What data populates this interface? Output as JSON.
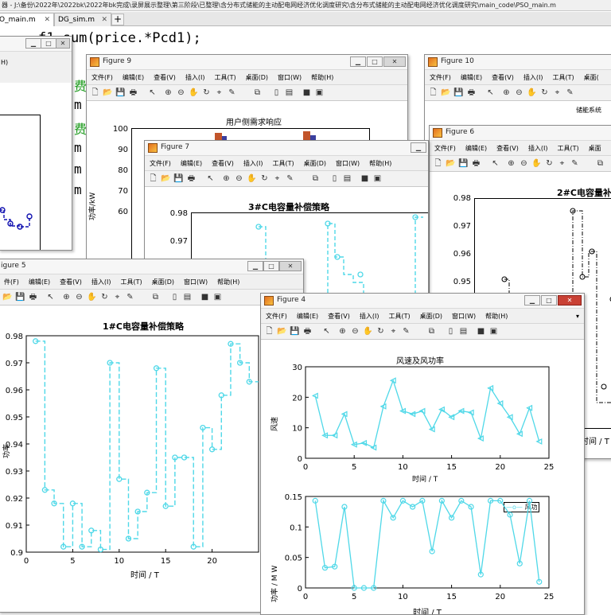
{
  "editor": {
    "path": "器 - J:\\备份\\2022年\\2022bk\\2022年bk完成\\录屏展示整理\\第三阶段\\已整理\\含分布式储能的主动配电网经济优化调度研究\\含分布式储能的主动配电网经济优化调度研究\\main_code\\PSO_main.m",
    "tabs": [
      {
        "label": "O_main.m"
      },
      {
        "label": "DG_sim.m"
      }
    ],
    "code_line": "f1=sum(price.*Pcd1);",
    "background_chars": [
      "费",
      "m",
      "费",
      "m",
      "m",
      "负",
      "m"
    ]
  },
  "win_partial": {
    "title_fragment": "H)"
  },
  "figure9": {
    "title": "Figure 9",
    "menu": [
      "文件(F)",
      "编辑(E)",
      "查看(V)",
      "插入(I)",
      "工具(T)",
      "桌面(D)",
      "窗口(W)",
      "帮助(H)"
    ],
    "chart_title": "用户侧需求响应",
    "yticks": [
      "100",
      "90",
      "80",
      "70",
      "60"
    ],
    "ylabel": "功率/kW"
  },
  "figure10": {
    "title": "Figure 10",
    "menu": [
      "文件(F)",
      "编辑(E)",
      "查看(V)",
      "插入(I)",
      "工具(T)",
      "桌面("
    ],
    "chart_title": "储能系统"
  },
  "figure6": {
    "title": "Figure 6",
    "menu": [
      "文件(F)",
      "编辑(E)",
      "查看(V)",
      "插入(I)",
      "工具(T)",
      "桌面"
    ],
    "chart_title": "2#C电容量补偿",
    "yticks": [
      "0.98",
      "0.97",
      "0.96",
      "0.95"
    ],
    "xlabel": "时间 / T"
  },
  "figure7": {
    "title": "Figure 7",
    "menu": [
      "文件(F)",
      "编辑(E)",
      "查看(V)",
      "插入(I)",
      "工具(T)",
      "桌面(D)",
      "窗口(W)",
      "帮助(H)"
    ],
    "chart_title": "3#C电容量补偿策略",
    "yticks": [
      "0.98",
      "0.97"
    ]
  },
  "figure5": {
    "title": "igure 5",
    "menu": [
      "件(F)",
      "编辑(E)",
      "查看(V)",
      "插入(I)",
      "工具(T)",
      "桌面(D)",
      "窗口(W)",
      "帮助(H)"
    ],
    "chart_title": "1#C电容量补偿策略",
    "yticks": [
      "0.98",
      "0.97",
      "0.96",
      "0.95",
      "0.94",
      "0.93",
      "0.92",
      "0.91",
      "0.9"
    ],
    "xticks": [
      "0",
      "5",
      "10",
      "15",
      "20"
    ],
    "xlabel": "时间 / T",
    "ylabel": "功率"
  },
  "figure4": {
    "title": "Figure 4",
    "menu": [
      "文件(F)",
      "编辑(E)",
      "查看(V)",
      "插入(I)",
      "工具(T)",
      "桌面(D)",
      "窗口(W)",
      "帮助(H)"
    ]
  },
  "colors": {
    "cyan": "#4fd8e8",
    "blue": "#1010b0",
    "black": "#000000"
  },
  "chart_data": [
    {
      "type": "line",
      "title": "1#C电容量补偿策略",
      "xlabel": "时间 / T",
      "ylabel": "功率",
      "xlim": [
        0,
        25
      ],
      "ylim": [
        0.9,
        0.98
      ],
      "style": "stairs-dashed",
      "series": [
        {
          "x": [
            1,
            2,
            3,
            4,
            5,
            6,
            7,
            8,
            9,
            10,
            11,
            12,
            13,
            14,
            15,
            16,
            17,
            18,
            19,
            20,
            21,
            22,
            23,
            24
          ],
          "values": [
            0.978,
            0.923,
            0.918,
            0.902,
            0.918,
            0.902,
            0.908,
            0.901,
            0.97,
            0.927,
            0.905,
            0.915,
            0.922,
            0.968,
            0.917,
            0.935,
            0.935,
            0.902,
            0.946,
            0.938,
            0.958,
            0.977,
            0.97,
            0.963
          ]
        }
      ]
    },
    {
      "type": "line",
      "title": "风速及风功率",
      "xlabel": "时间 / T",
      "ylabel": "风速",
      "xlim": [
        0,
        25
      ],
      "ylim": [
        0,
        30
      ],
      "yticks": [
        0,
        10,
        20,
        30
      ],
      "xticks": [
        0,
        5,
        10,
        15,
        20,
        25
      ],
      "series": [
        {
          "x": [
            1,
            2,
            3,
            4,
            5,
            6,
            7,
            8,
            9,
            10,
            11,
            12,
            13,
            14,
            15,
            16,
            17,
            18,
            19,
            20,
            21,
            22,
            23,
            24
          ],
          "values": [
            20.5,
            7.5,
            7.5,
            14.5,
            4.5,
            5,
            3.5,
            17,
            25.5,
            15.5,
            14.5,
            15.5,
            9.5,
            16,
            13.5,
            15.5,
            15,
            6.5,
            23,
            18,
            13.5,
            8,
            16.5,
            5.5
          ]
        }
      ]
    },
    {
      "type": "line",
      "title": "",
      "xlabel": "时间 / T",
      "ylabel": "功率 / M W",
      "xlim": [
        0,
        25
      ],
      "ylim": [
        0,
        0.15
      ],
      "yticks": [
        0,
        0.05,
        0.1,
        0.15
      ],
      "xticks": [
        0,
        5,
        10,
        15,
        20,
        25
      ],
      "legend": "top-right",
      "series": [
        {
          "name": "风功",
          "x": [
            1,
            2,
            3,
            4,
            5,
            6,
            7,
            8,
            9,
            10,
            11,
            12,
            13,
            14,
            15,
            16,
            17,
            18,
            19,
            20,
            21,
            22,
            23,
            24
          ],
          "values": [
            0.143,
            0.033,
            0.035,
            0.133,
            0,
            0,
            0,
            0.143,
            0.115,
            0.143,
            0.133,
            0.143,
            0.06,
            0.143,
            0.115,
            0.143,
            0.133,
            0.022,
            0.143,
            0.143,
            0.12,
            0.04,
            0.143,
            0.01
          ]
        }
      ]
    },
    {
      "type": "line",
      "title": "3#C电容量补偿策略",
      "ylim": [
        0.95,
        0.98
      ],
      "style": "stairs-dashed",
      "series": [
        {
          "x": [
            1,
            2,
            3,
            4,
            5,
            6,
            7,
            8,
            9,
            10,
            11,
            12,
            13,
            14,
            15,
            16,
            17,
            18,
            19,
            20,
            21,
            22,
            23,
            24
          ],
          "values": [
            0.95,
            0.95,
            0.95,
            0.95,
            0.95,
            0.95,
            0.95,
            0.95,
            0.975,
            0.95,
            0.95,
            0.95,
            0.95,
            0.95,
            0.95,
            0.95,
            0.976,
            0.966,
            0.962,
            0.96,
            0.95,
            0.95,
            0.95,
            0.978
          ]
        }
      ]
    },
    {
      "type": "line",
      "title": "2#C电容量补偿",
      "ylim": [
        0.945,
        0.98
      ],
      "style": "stairs-dashdot",
      "series": [
        {
          "x": [
            1,
            2,
            3,
            4,
            5,
            6,
            7,
            8,
            9,
            10,
            11,
            12
          ],
          "values": [
            0.951,
            0.949,
            0.949,
            0.949,
            0.949,
            0.949,
            0.975,
            0.952,
            0.961,
            0.949,
            0.949,
            0.949
          ]
        }
      ]
    }
  ]
}
